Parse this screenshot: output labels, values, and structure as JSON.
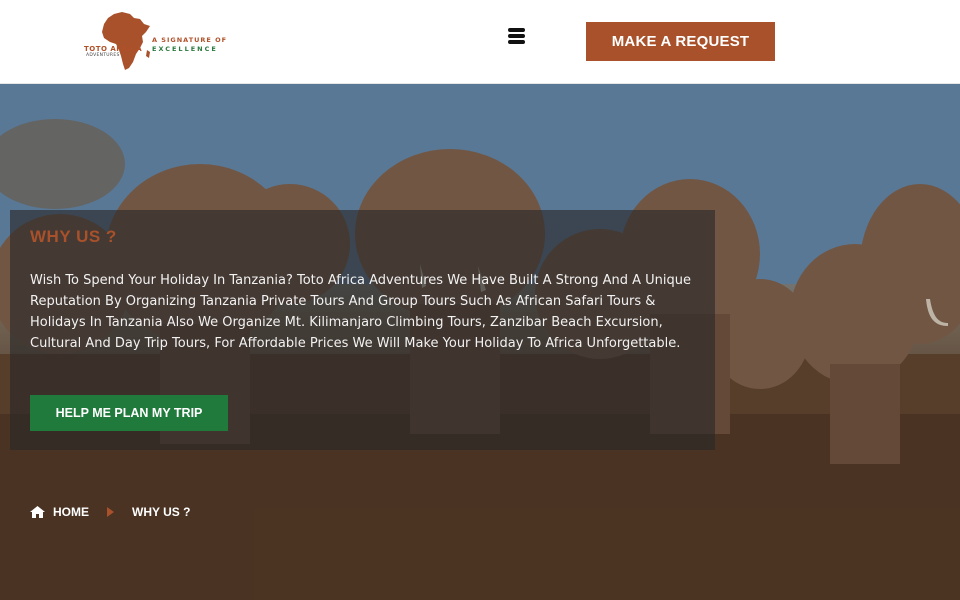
{
  "header": {
    "logo": {
      "brand_line1": "TOTO AFRICA",
      "brand_line2": "ADVENTURES",
      "tagline_line1": "A SIGNATURE OF",
      "tagline_line2": "EXCELLENCE",
      "brand_color": "#a8512a",
      "accent_color": "#2a7a3e"
    },
    "menu_icon": "hamburger-icon",
    "request_button": "MAKE A REQUEST"
  },
  "hero": {
    "title": "WHY US ?",
    "intro": "Wish To Spend Your Holiday In Tanzania? Toto Africa Adventures We Have Built A Strong And A Unique Reputation By Organizing Tanzania Private Tours And Group Tours Such As African Safari Tours & Holidays In Tanzania Also We Organize Mt. Kilimanjaro Climbing Tours, Zanzibar Beach Excursion, Cultural And Day Trip Tours, For Affordable Prices We Will Make Your Holiday To Africa Unforgettable.",
    "cta_button": "HELP ME PLAN MY TRIP",
    "cta_color": "#1f7a3c",
    "title_color": "#a8512a"
  },
  "breadcrumb": {
    "home_icon": "home-icon",
    "separator_icon": "caret-right-icon",
    "items": [
      "HOME",
      "WHY US ?"
    ]
  }
}
